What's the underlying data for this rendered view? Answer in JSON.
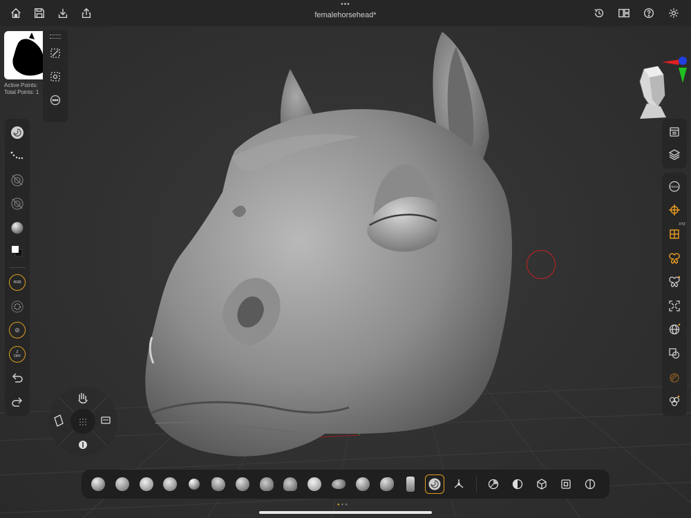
{
  "document": {
    "title": "femalehorsehead*"
  },
  "top_bar": {
    "left_icons": [
      "home-icon",
      "save-icon",
      "import-icon",
      "share-icon"
    ],
    "right_icons": [
      "history-icon",
      "layout-icon",
      "help-icon",
      "settings-icon"
    ]
  },
  "info": {
    "active_points_label": "Active Points:",
    "total_points_label": "Total Points: 1"
  },
  "left_toolbar": {
    "items": [
      "brush-icon",
      "stroke-icon",
      "alpha-icon",
      "texture-icon",
      "material-icon",
      "color-swatch-icon",
      "rgb-icon",
      "draw-size-icon",
      "intensity-icon",
      "zoff-icon",
      "undo-icon",
      "redo-icon"
    ],
    "rgb_label": "RGB",
    "zoff_label_top": "Z",
    "zoff_label_bottom": "OFF"
  },
  "right_toolbar": {
    "group1": [
      "doc-icon",
      "layers-icon"
    ],
    "group2": [
      "persp-icon",
      "floor-icon",
      "local-icon",
      "symmetry-icon",
      "polyframe-icon",
      "frame-icon",
      "solo-icon",
      "transp-icon",
      "ghost-icon",
      "bpr-icon"
    ],
    "persp_label": "PERS",
    "xyz_label": "XYZ"
  },
  "colors": {
    "accent": "#f0a020",
    "cursor": "#c82020",
    "panel": "#262626",
    "background": "#2f2f2f"
  },
  "brush_bar": {
    "brushes": [
      "standard",
      "clay",
      "claybuildup",
      "move",
      "damstandard",
      "inflate",
      "pinch",
      "hpolish",
      "trimdynamic",
      "smooth",
      "snakehook",
      "flatten",
      "mallet",
      "chisel",
      "current"
    ],
    "active_index": 14,
    "tools": [
      "gizmo-icon",
      "matcap-icon",
      "polypaint-icon",
      "cube-icon",
      "mask-icon",
      "split-icon"
    ]
  }
}
